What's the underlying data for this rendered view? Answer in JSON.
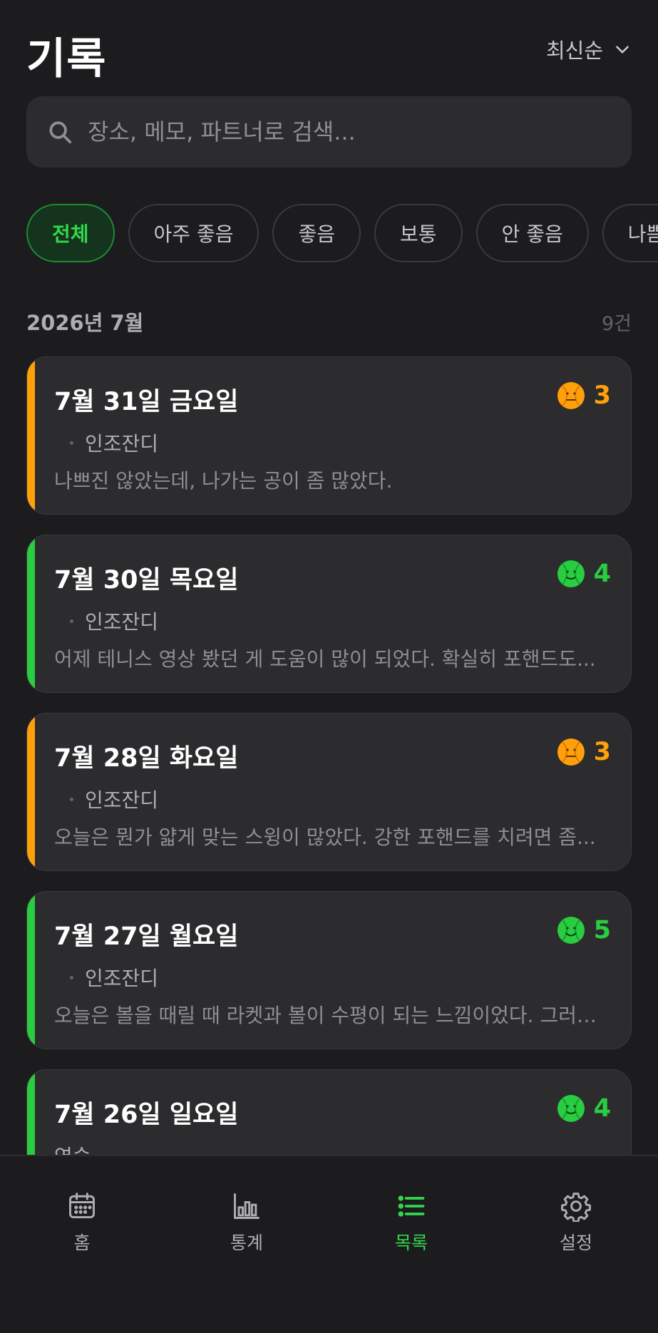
{
  "header": {
    "title": "기록",
    "sort_label": "최신순"
  },
  "search": {
    "placeholder": "장소, 메모, 파트너로 검색..."
  },
  "filters": [
    "전체",
    "아주 좋음",
    "좋음",
    "보통",
    "안 좋음",
    "나쁨"
  ],
  "active_filter": "전체",
  "section": {
    "month": "2026년 7월",
    "count": "9건"
  },
  "records": [
    {
      "date": "7월 31일 금요일",
      "rating": "3",
      "location": "인조잔디",
      "memo": "나쁘진 않았는데, 나가는 공이 좀 많았다.",
      "color": "#ff9f0a"
    },
    {
      "date": "7월 30일 목요일",
      "rating": "4",
      "location": "인조잔디",
      "memo": "어제 테니스 영상 봤던 게 도움이 많이 되었다. 확실히 포핸드도...",
      "color": "#28cd41"
    },
    {
      "date": "7월 28일 화요일",
      "rating": "3",
      "location": "인조잔디",
      "memo": "오늘은 뭔가 얇게 맞는 스윙이 많았다. 강한 포핸드를 치려면 좀...",
      "color": "#ff9f0a"
    },
    {
      "date": "7월 27일 월요일",
      "rating": "5",
      "location": "인조잔디",
      "memo": "오늘은 볼을 때릴 때 라켓과 볼이 수평이 되는 느낌이었다. 그러다…",
      "color": "#28cd41"
    },
    {
      "date": "7월 26일 일요일",
      "rating": "4",
      "location": "연습",
      "memo": "",
      "color": "#28cd41"
    }
  ],
  "tabs": [
    "홈",
    "통계",
    "목록",
    "설정"
  ],
  "colors": {
    "accent": "#32d74b",
    "good": "#28cd41",
    "average": "#ff9f0a",
    "background": "#1c1c1e",
    "card": "#2c2c2e"
  }
}
